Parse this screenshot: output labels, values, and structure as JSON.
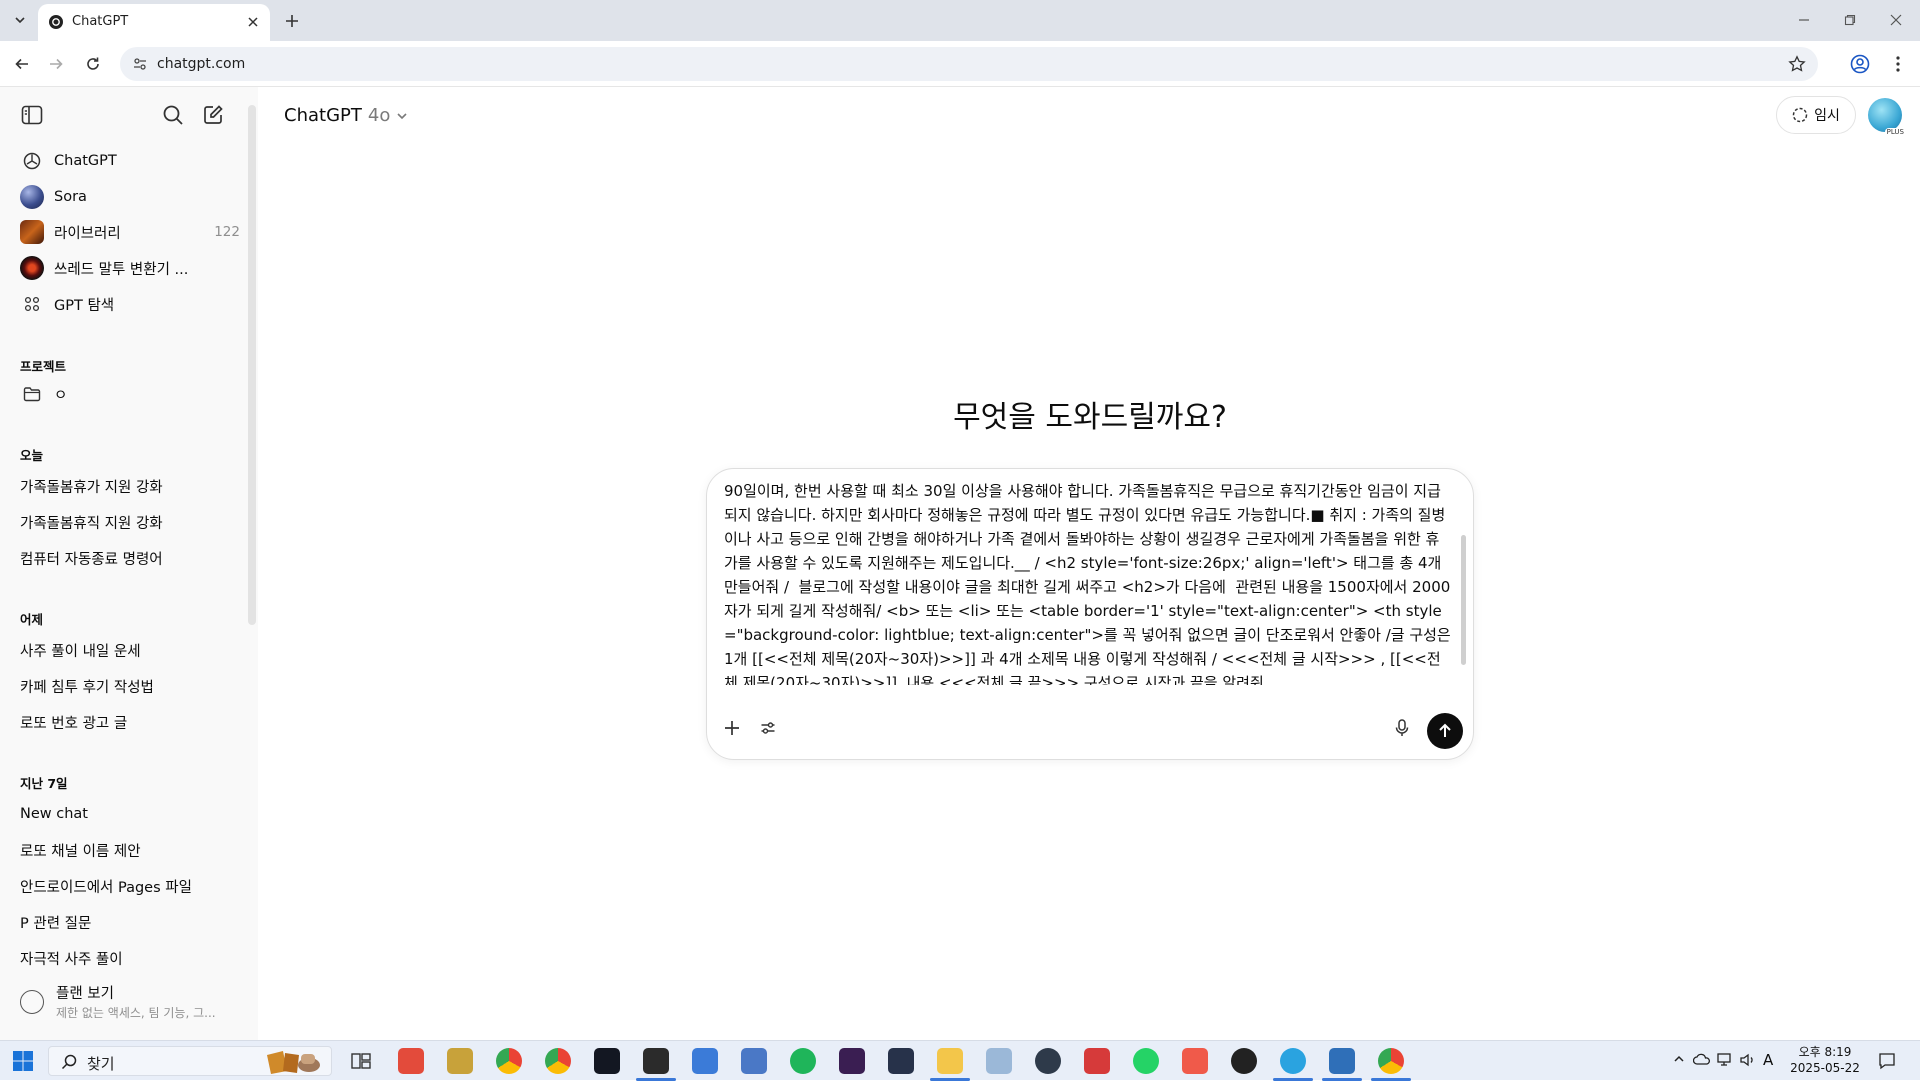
{
  "browser": {
    "tab_title": "ChatGPT",
    "url": "chatgpt.com"
  },
  "sidebar": {
    "items": [
      {
        "label": "ChatGPT",
        "icon": "chatgpt-logo-icon"
      },
      {
        "label": "Sora",
        "icon": "sora-icon"
      },
      {
        "label": "라이브러리",
        "icon": "library-icon",
        "count": "122"
      },
      {
        "label": "쓰레드 말투 변환기 ...",
        "icon": "custom-gpt-icon"
      },
      {
        "label": "GPT 탐색",
        "icon": "grid-icon"
      }
    ],
    "projects_heading": "프로젝트",
    "projects": [
      {
        "label": "ㅇ",
        "icon": "folder-icon"
      }
    ],
    "today_heading": "오늘",
    "today": [
      "가족돌봄휴가 지원 강화",
      "가족돌봄휴직 지원 강화",
      "컴퓨터 자동종료 명령어"
    ],
    "yesterday_heading": "어제",
    "yesterday": [
      "사주 풀이 내일 운세",
      "카페 침투 후기 작성법",
      "로또 번호 광고 글"
    ],
    "week_heading": "지난 7일",
    "week": [
      "New chat",
      "로또 채널 이름 제안",
      "안드로이드에서 Pages 파일",
      "P 관련 질문",
      "자극적 사주 풀이"
    ],
    "plan_title": "플랜 보기",
    "plan_subtitle": "제한 없는 액세스, 팀 기능, 그..."
  },
  "header": {
    "app_name": "ChatGPT",
    "model": "4o",
    "temp_chat_label": "임시",
    "avatar_badge": "PLUS"
  },
  "main": {
    "headline": "무엇을 도와드릴까요?",
    "composer_text": "90일이며, 한번 사용할 때 최소 30일 이상을 사용해야 합니다. 가족돌봄휴직은 무급으로 휴직기간동안 임금이 지급되지 않습니다. 하지만 회사마다 정해놓은 규정에 따라 별도 규정이 있다면 유급도 가능합니다.■ 취지 : 가족의 질병이나 사고 등으로 인해 간병을 해야하거나 가족 곁에서 돌봐야하는 상황이 생길경우 근로자에게 가족돌봄을 위한 휴가를 사용할 수 있도록 지원해주는 제도입니다.__ / <h2 style='font-size:26px;' align='left'> 태그를 총 4개 만들어줘 /  블로그에 작성할 내용이야 글을 최대한 길게 써주고 <h2>가 다음에  관련된 내용을 1500자에서 2000자가 되게 길게 작성해줘/ <b> 또는 <li> 또는 <table border='1' style=\"text-align:center\"> <th style=\"background-color: lightblue; text-align:center\">를 꼭 넣어줘 없으면 글이 단조로워서 안좋아 /글 구성은 1개 [[<<전체 제목(20자~30자)>>]] 과 4개 소제목 내용 이렇게 작성해줘 / <<<전체 글 시작>>> , [[<<전체 제목(20자~30자)>>]], 내용 <<<전체 글 끝>>> 구성으로 시작과 끝을 알려줘"
  },
  "taskbar": {
    "search_label": "찾기",
    "time": "오후 8:19",
    "date": "2025-05-22",
    "ime": "A"
  }
}
